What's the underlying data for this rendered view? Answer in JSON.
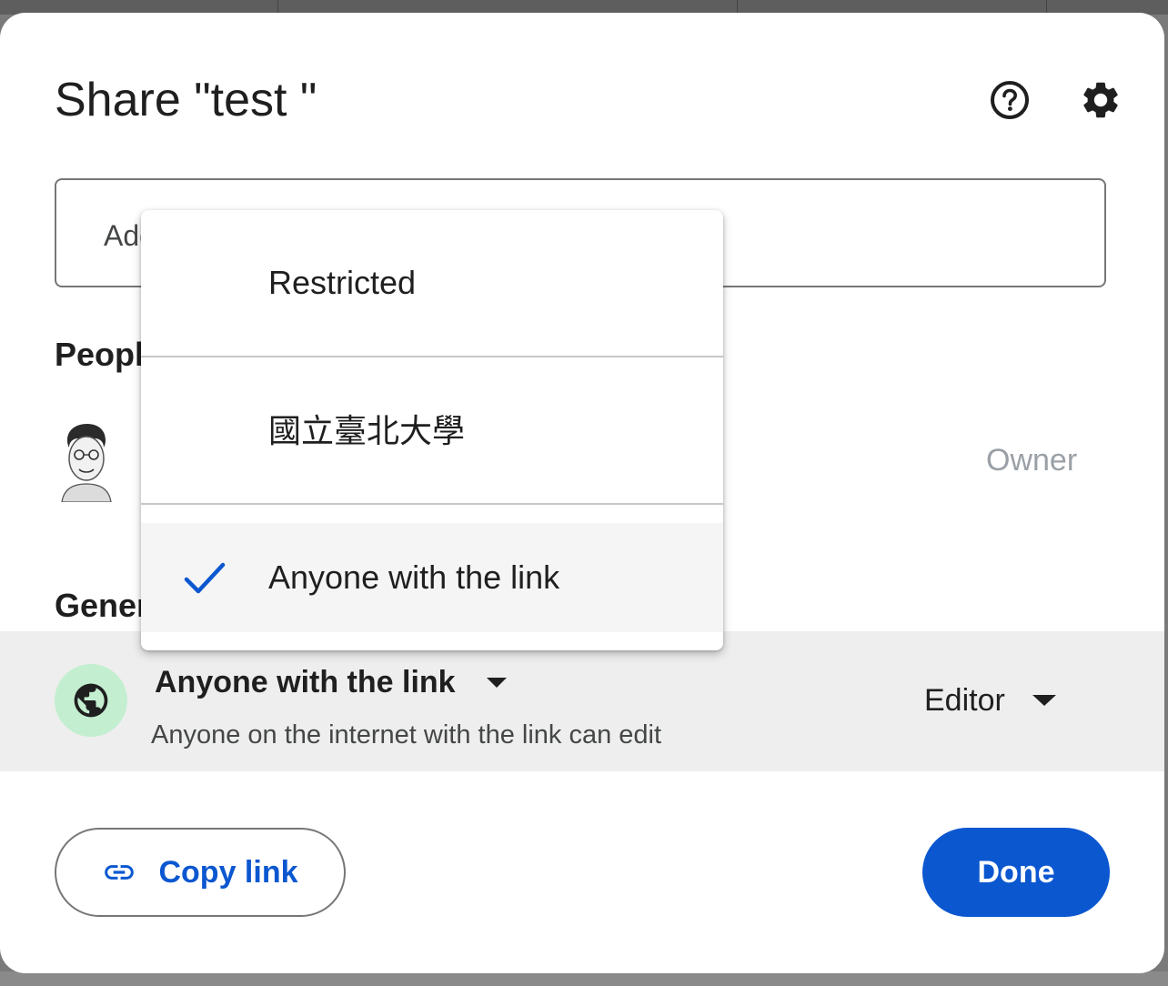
{
  "dialog": {
    "title": "Share \"test \""
  },
  "add_people": {
    "placeholder": "Add people, groups, and calendar events"
  },
  "people_section": {
    "title": "People with access",
    "owner_role": "Owner"
  },
  "general_section": {
    "title": "General access",
    "access_value": "Anyone with the link",
    "access_description": "Anyone on the internet with the link can edit",
    "role_value": "Editor"
  },
  "access_menu": {
    "items": [
      {
        "label": "Restricted",
        "selected": false
      },
      {
        "label": "國立臺北大學",
        "selected": false
      },
      {
        "label": "Anyone with the link",
        "selected": true
      }
    ]
  },
  "buttons": {
    "copy_link": "Copy link",
    "done": "Done"
  },
  "icons": {
    "help": "help-icon",
    "settings": "gear-icon",
    "globe": "globe-icon",
    "link": "link-icon",
    "check": "check-icon"
  },
  "colors": {
    "accent": "#0b57d0",
    "globe_bg": "#c4eed0",
    "selected_row_bg": "#eeeeee",
    "check": "#0b57d0"
  }
}
